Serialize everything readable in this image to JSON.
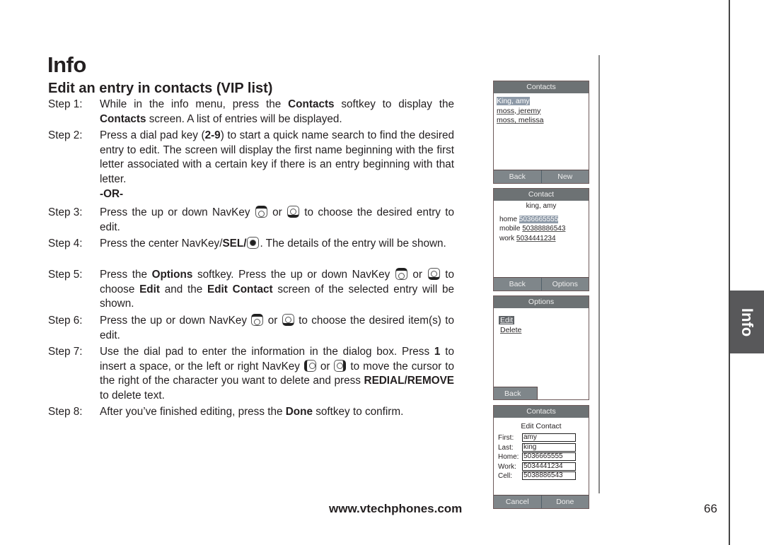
{
  "page": {
    "section_title": "Info",
    "subsection_title": "Edit an entry in contacts (VIP list)",
    "side_tab_label": "Info",
    "footer_url": "www.vtechphones.com",
    "page_number": "66"
  },
  "steps": [
    {
      "num": "Step 1:",
      "parts": [
        "While in the info menu, press the ",
        "Contacts",
        " softkey to display the ",
        "Contacts",
        " screen. A list of entries will be displayed."
      ]
    },
    {
      "num": "Step 2:",
      "parts": [
        "Press a dial pad key (",
        "2-9",
        ") to start a quick name search to find the desired entry to edit. The screen will display the first name beginning with the first letter associated with a certain key if there is an entry beginning with that letter."
      ]
    },
    {
      "or": "-OR-"
    },
    {
      "num": "Step 3:",
      "parts": [
        "Press the up or down NavKey ",
        " or ",
        " to choose the desired entry to edit."
      ],
      "icons": [
        "navkey-up-icon",
        "navkey-down-icon"
      ]
    },
    {
      "num": "Step 4:",
      "parts": [
        "Press the center NavKey/",
        "SEL",
        "/",
        ". The details of the entry will be shown."
      ],
      "icons": [
        "navkey-select-icon"
      ]
    },
    {
      "num": "Step 5:",
      "parts": [
        "Press the ",
        "Options",
        " softkey. Press the up or down NavKey ",
        " or ",
        " to choose ",
        "Edit",
        " and the ",
        "Edit Contact",
        " screen of the selected entry will be shown."
      ],
      "icons": [
        "navkey-up-icon",
        "navkey-down-icon"
      ]
    },
    {
      "num": "Step 6:",
      "parts": [
        "Press the up or down NavKey ",
        " or ",
        " to choose the desired item(s) to edit."
      ],
      "icons": [
        "navkey-up-icon",
        "navkey-down-icon"
      ]
    },
    {
      "num": "Step 7:",
      "parts": [
        "Use the dial pad to enter the information in the dialog box. Press ",
        "1",
        " to insert a space, or the left or right NavKey ",
        " or ",
        " to move the cursor to the right of the character you want to delete and press ",
        "REDIAL/REMOVE",
        " to delete text."
      ],
      "icons": [
        "navkey-left-icon",
        "navkey-right-icon"
      ]
    },
    {
      "num": "Step 8:",
      "parts": [
        "After you’ve finished editing, press the ",
        "Done",
        " softkey to confirm."
      ]
    }
  ],
  "screens": {
    "contacts_list": {
      "title": "Contacts",
      "entries": [
        "King, amy",
        "moss, jeremy",
        "moss, melissa"
      ],
      "selected_index": 0,
      "softkeys": [
        "Back",
        "New"
      ]
    },
    "contact_detail": {
      "title": "Contact",
      "name": "king, amy",
      "numbers": [
        {
          "label": "home",
          "value": "5036665555"
        },
        {
          "label": "mobile",
          "value": "50388886543"
        },
        {
          "label": "work",
          "value": "5034441234"
        }
      ],
      "softkeys": [
        "Back",
        "Options"
      ]
    },
    "options": {
      "title": "Options",
      "items": [
        "Edit",
        "Delete"
      ],
      "selected_index": 0,
      "softkeys": [
        "Back"
      ]
    },
    "edit_contact": {
      "title": "Contacts",
      "subtitle": "Edit Contact",
      "fields": [
        {
          "label": "First:",
          "value": "amy"
        },
        {
          "label": "Last:",
          "value": "king"
        },
        {
          "label": "Home:",
          "value": "5036665555"
        },
        {
          "label": "Work:",
          "value": "5034441234"
        },
        {
          "label": "Cell:",
          "value": "5038886543"
        }
      ],
      "softkeys": [
        "Cancel",
        "Done"
      ]
    }
  }
}
